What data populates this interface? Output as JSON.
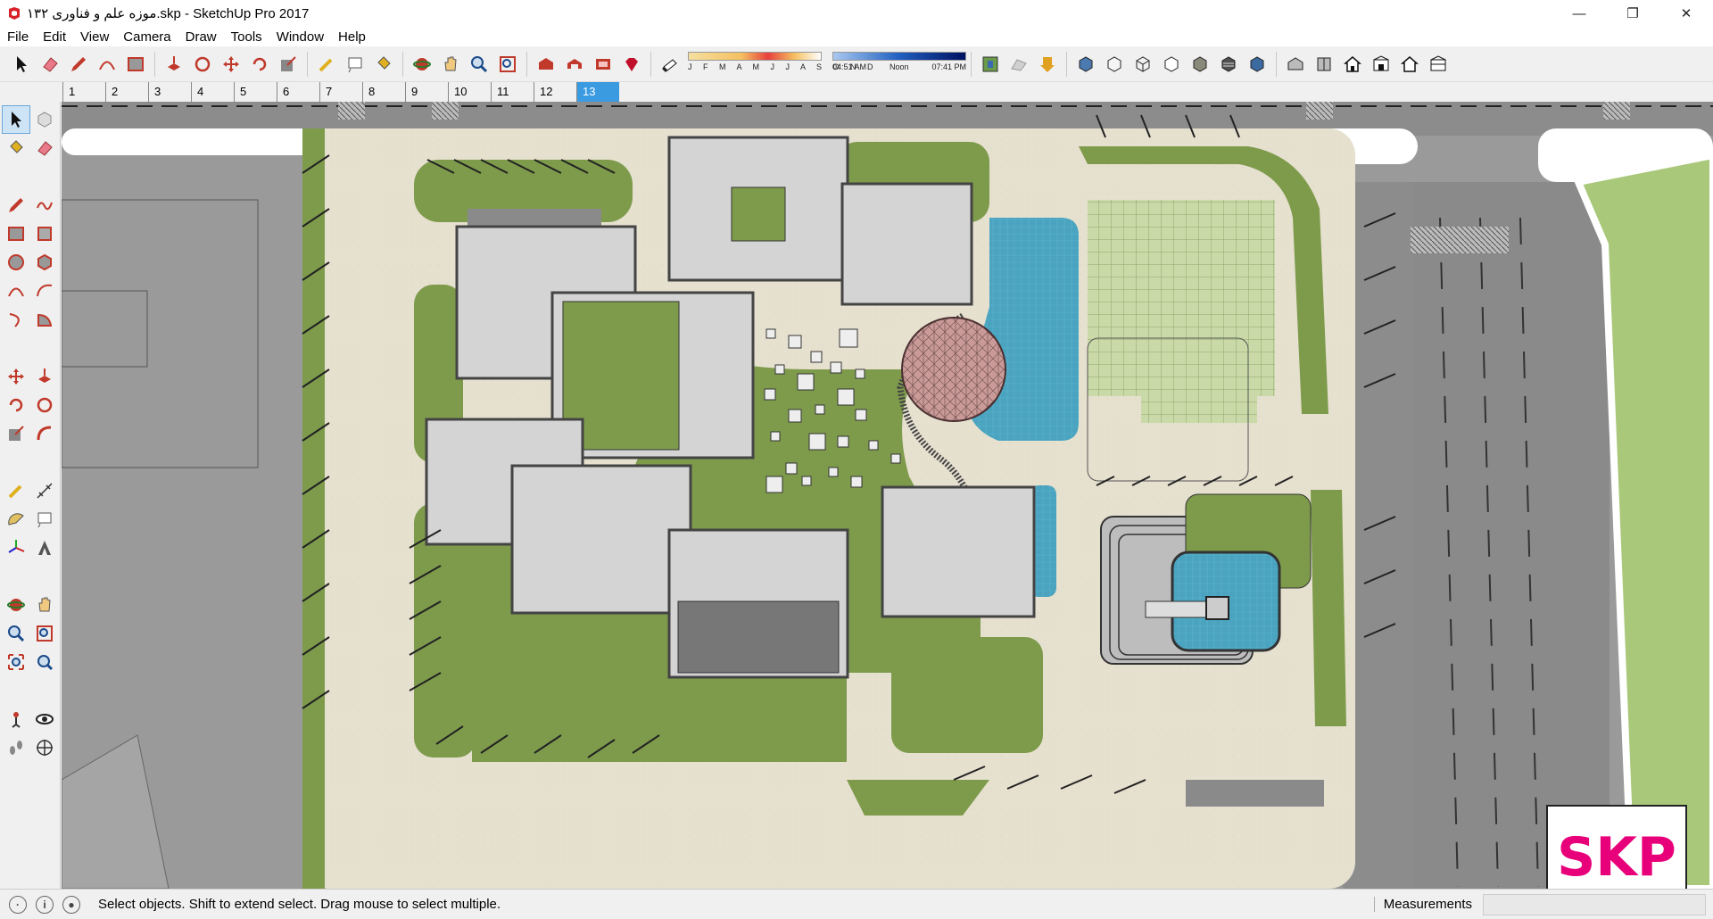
{
  "window": {
    "title": "موزه علم و فناوری ۱۳۲.skp - SketchUp Pro 2017",
    "minimize_icon": "minimize-icon",
    "maximize_icon": "restore-icon",
    "close_icon": "close-icon"
  },
  "menu": {
    "items": [
      "File",
      "Edit",
      "View",
      "Camera",
      "Draw",
      "Tools",
      "Window",
      "Help"
    ]
  },
  "shadows": {
    "months": "J F M A M J J A S O N D",
    "time_start": "04:51 AM",
    "time_mid": "Noon",
    "time_end": "07:41 PM"
  },
  "scenes": {
    "tabs": [
      "1",
      "2",
      "3",
      "4",
      "5",
      "6",
      "7",
      "8",
      "9",
      "10",
      "11",
      "12",
      "13"
    ],
    "active_index": 12
  },
  "status": {
    "hint": "Select objects. Shift to extend select. Drag mouse to select multiple.",
    "measurements_label": "Measurements",
    "measurements_value": ""
  },
  "watermark": {
    "text": "SKP"
  },
  "colors": {
    "accent": "#3a9be0",
    "grass": "#7e9b4c",
    "paving": "#e6e0cf",
    "road": "#8f8f8f",
    "water": "#4aa3bf",
    "roof": "#d4d4d4"
  }
}
